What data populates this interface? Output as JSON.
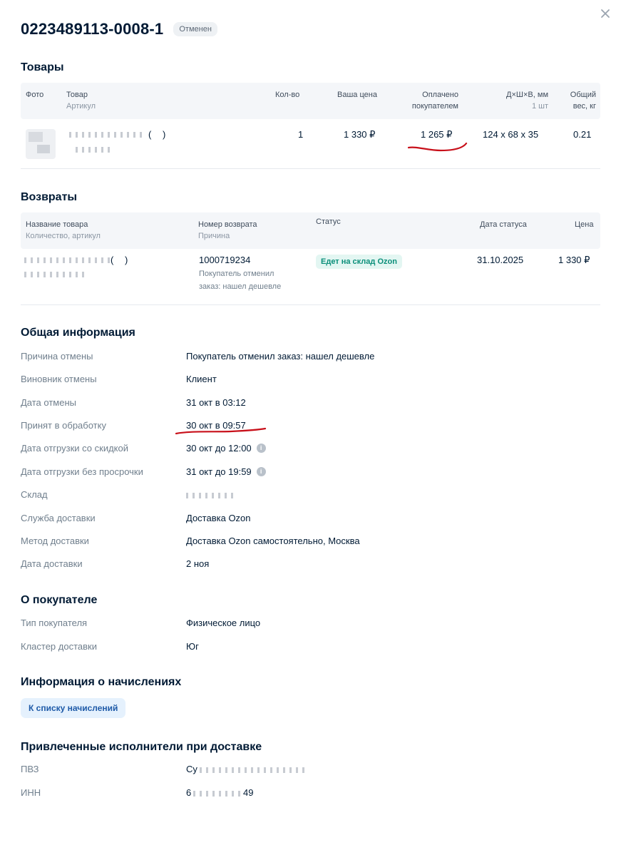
{
  "header": {
    "order_number": "0223489113-0008-1",
    "status": "Отменен"
  },
  "products": {
    "title": "Товары",
    "columns": {
      "photo": "Фото",
      "product": "Товар",
      "product_sub": "Артикул",
      "qty": "Кол-во",
      "your_price": "Ваша цена",
      "paid": "Оплачено",
      "paid_sub": "покупателем",
      "dims": "Д×Ш×В, мм",
      "dims_sub": "1 шт",
      "weight": "Общий",
      "weight_sub": "вес, кг"
    },
    "row": {
      "name": "(    )",
      "qty": "1",
      "your_price": "1 330 ₽",
      "paid": "1 265 ₽",
      "dims": "124 x 68 x 35",
      "weight": "0.21"
    }
  },
  "returns": {
    "title": "Возвраты",
    "columns": {
      "name": "Название товара",
      "name_sub": "Количество, артикул",
      "number": "Номер возврата",
      "number_sub": "Причина",
      "status": "Статус",
      "status_date": "Дата статуса",
      "price": "Цена"
    },
    "row": {
      "name": "(    )",
      "number": "1000719234",
      "reason_line1": "Покупатель отменил",
      "reason_line2": "заказ: нашел дешевле",
      "status": "Едет на склад Ozon",
      "status_date": "31.10.2025",
      "price": "1 330 ₽"
    }
  },
  "general": {
    "title": "Общая информация",
    "rows": [
      {
        "label": "Причина отмены",
        "value": "Покупатель отменил заказ: нашел дешевле"
      },
      {
        "label": "Виновник отмены",
        "value": "Клиент"
      },
      {
        "label": "Дата отмены",
        "value": "31 окт в 03:12"
      },
      {
        "label": "Принят в обработку",
        "value": "30 окт в 09:57"
      },
      {
        "label": "Дата отгрузки со скидкой",
        "value": "30 окт до 12:00"
      },
      {
        "label": "Дата отгрузки без просрочки",
        "value": "31 окт до 19:59"
      },
      {
        "label": "Склад",
        "value": ""
      },
      {
        "label": "Служба доставки",
        "value": "Доставка Ozon"
      },
      {
        "label": "Метод доставки",
        "value": "Доставка Ozon самостоятельно, Москва"
      },
      {
        "label": "Дата доставки",
        "value": "2 ноя"
      }
    ]
  },
  "buyer": {
    "title": "О покупателе",
    "rows": [
      {
        "label": "Тип покупателя",
        "value": "Физическое лицо"
      },
      {
        "label": "Кластер доставки",
        "value": "Юг"
      }
    ]
  },
  "accruals": {
    "title": "Информация о начислениях",
    "button": "К списку начислений"
  },
  "contractors": {
    "title": "Привлеченные исполнители при доставке",
    "rows": [
      {
        "label": "ПВЗ",
        "value": "Су"
      },
      {
        "label": "ИНН",
        "value": "6"
      }
    ],
    "inn_tail": "49"
  },
  "colors": {
    "accent": "#005bff",
    "status_green": "#0b8f7a",
    "annotation_red": "#c8101a"
  }
}
